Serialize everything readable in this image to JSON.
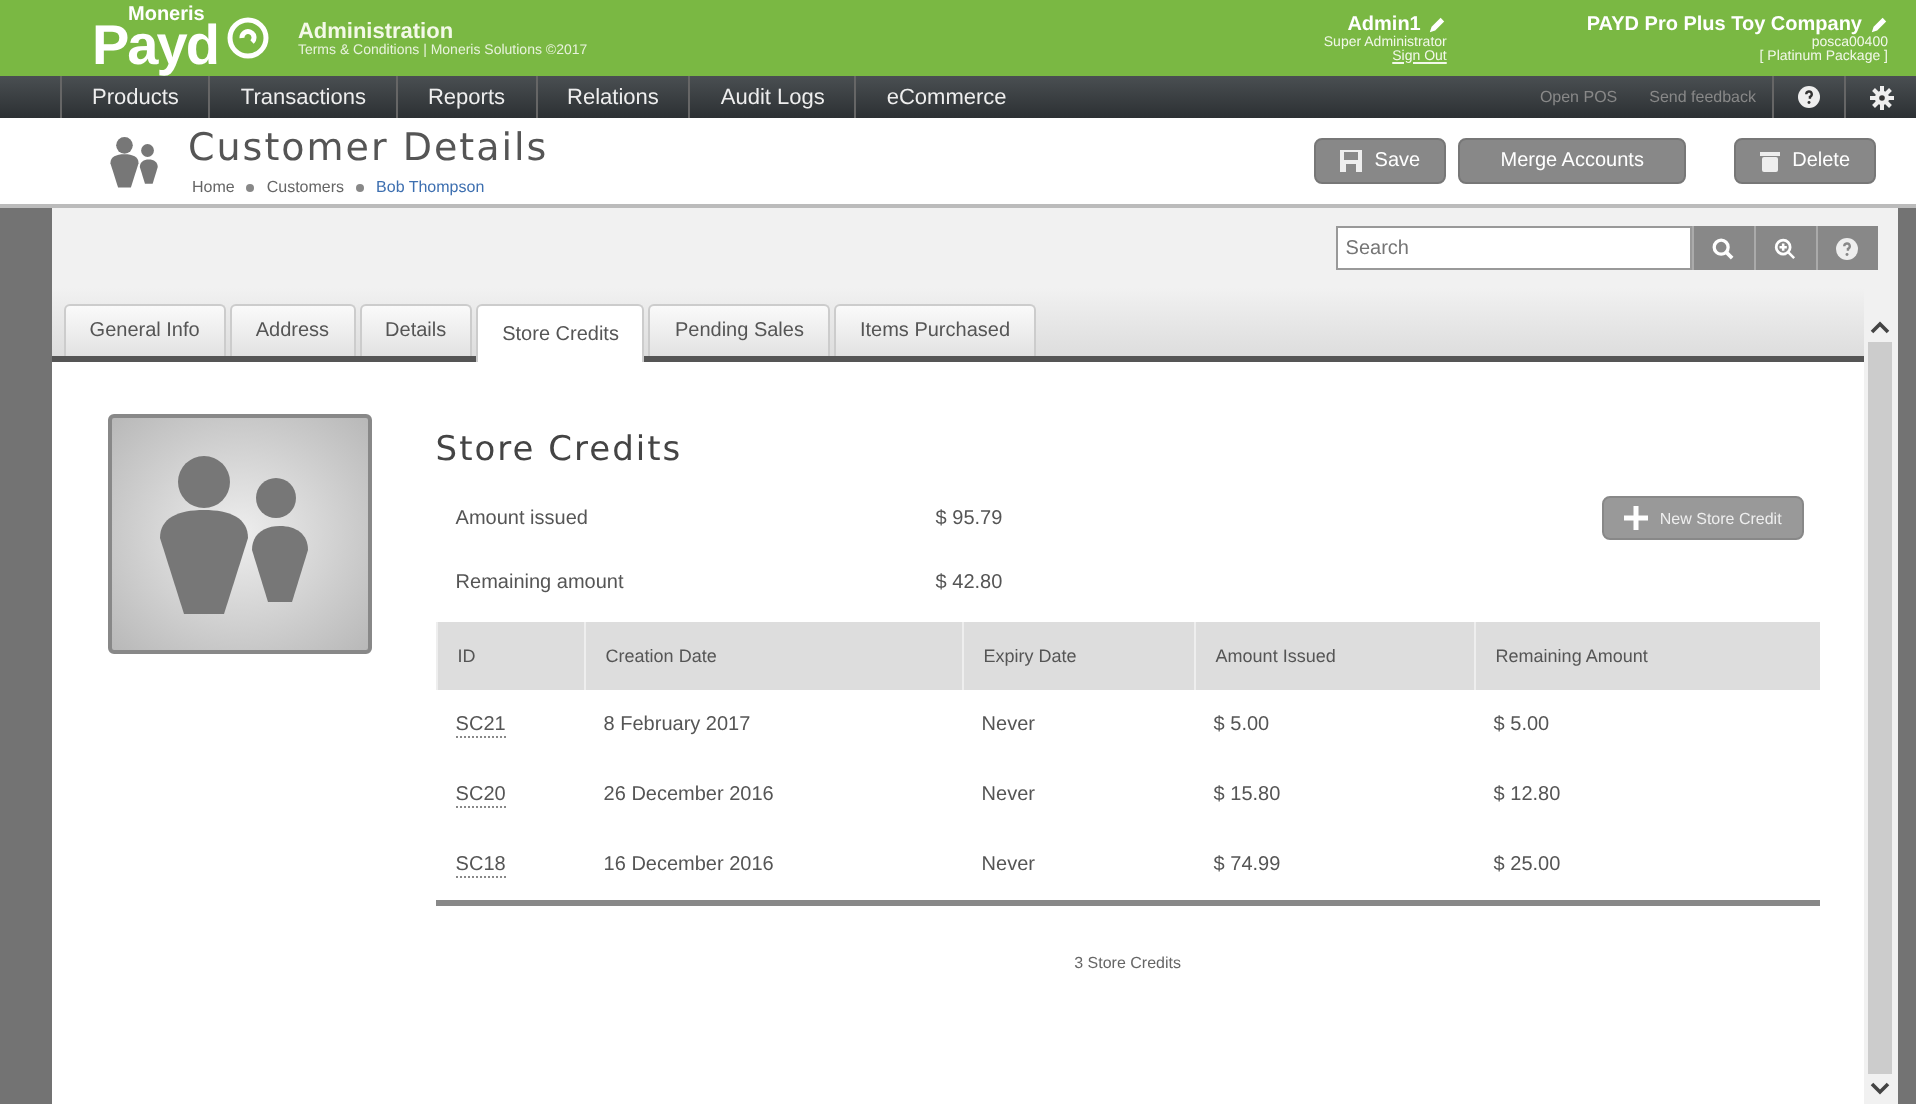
{
  "header": {
    "logo": {
      "brand": "Moneris",
      "name": "Payd"
    },
    "title": "Administration",
    "subtitle": "Terms & Conditions | Moneris Solutions ©2017",
    "user": {
      "name": "Admin1",
      "role": "Super Administrator",
      "link": "Sign Out"
    },
    "company": {
      "name": "PAYD Pro Plus Toy Company",
      "code": "posca00400",
      "package": "[ Platinum Package ]"
    }
  },
  "nav": {
    "items": [
      "Products",
      "Transactions",
      "Reports",
      "Relations",
      "Audit Logs",
      "eCommerce"
    ],
    "actions": [
      "Open POS",
      "Send feedback"
    ]
  },
  "page": {
    "title": "Customer Details",
    "breadcrumb": [
      {
        "label": "Home",
        "current": false
      },
      {
        "label": "Customers",
        "current": false
      },
      {
        "label": "Bob Thompson",
        "current": true
      }
    ],
    "buttons": [
      "Save",
      "Merge Accounts",
      "Delete"
    ]
  },
  "search": {
    "placeholder": "Search"
  },
  "tabs": [
    {
      "label": "General Info",
      "selected": false
    },
    {
      "label": "Address",
      "selected": false
    },
    {
      "label": "Details",
      "selected": false
    },
    {
      "label": "Store Credits",
      "selected": true
    },
    {
      "label": "Pending Sales",
      "selected": false
    },
    {
      "label": "Items Purchased",
      "selected": false
    }
  ],
  "section": {
    "title": "Store Credits",
    "summary": [
      {
        "label": "Amount issued",
        "value": "$ 95.79"
      },
      {
        "label": "Remaining amount",
        "value": "$ 42.80"
      }
    ],
    "new_button": "New Store Credit"
  },
  "table": {
    "columns": [
      "ID",
      "Creation Date",
      "Expiry Date",
      "Amount Issued",
      "Remaining Amount"
    ],
    "rows": [
      [
        "SC21",
        "8 February 2017",
        "Never",
        "$ 5.00",
        "$ 5.00"
      ],
      [
        "SC20",
        "26 December 2016",
        "Never",
        "$ 15.80",
        "$ 12.80"
      ],
      [
        "SC18",
        "16 December 2016",
        "Never",
        "$ 74.99",
        "$ 25.00"
      ]
    ],
    "footer": "3 Store Credits"
  }
}
